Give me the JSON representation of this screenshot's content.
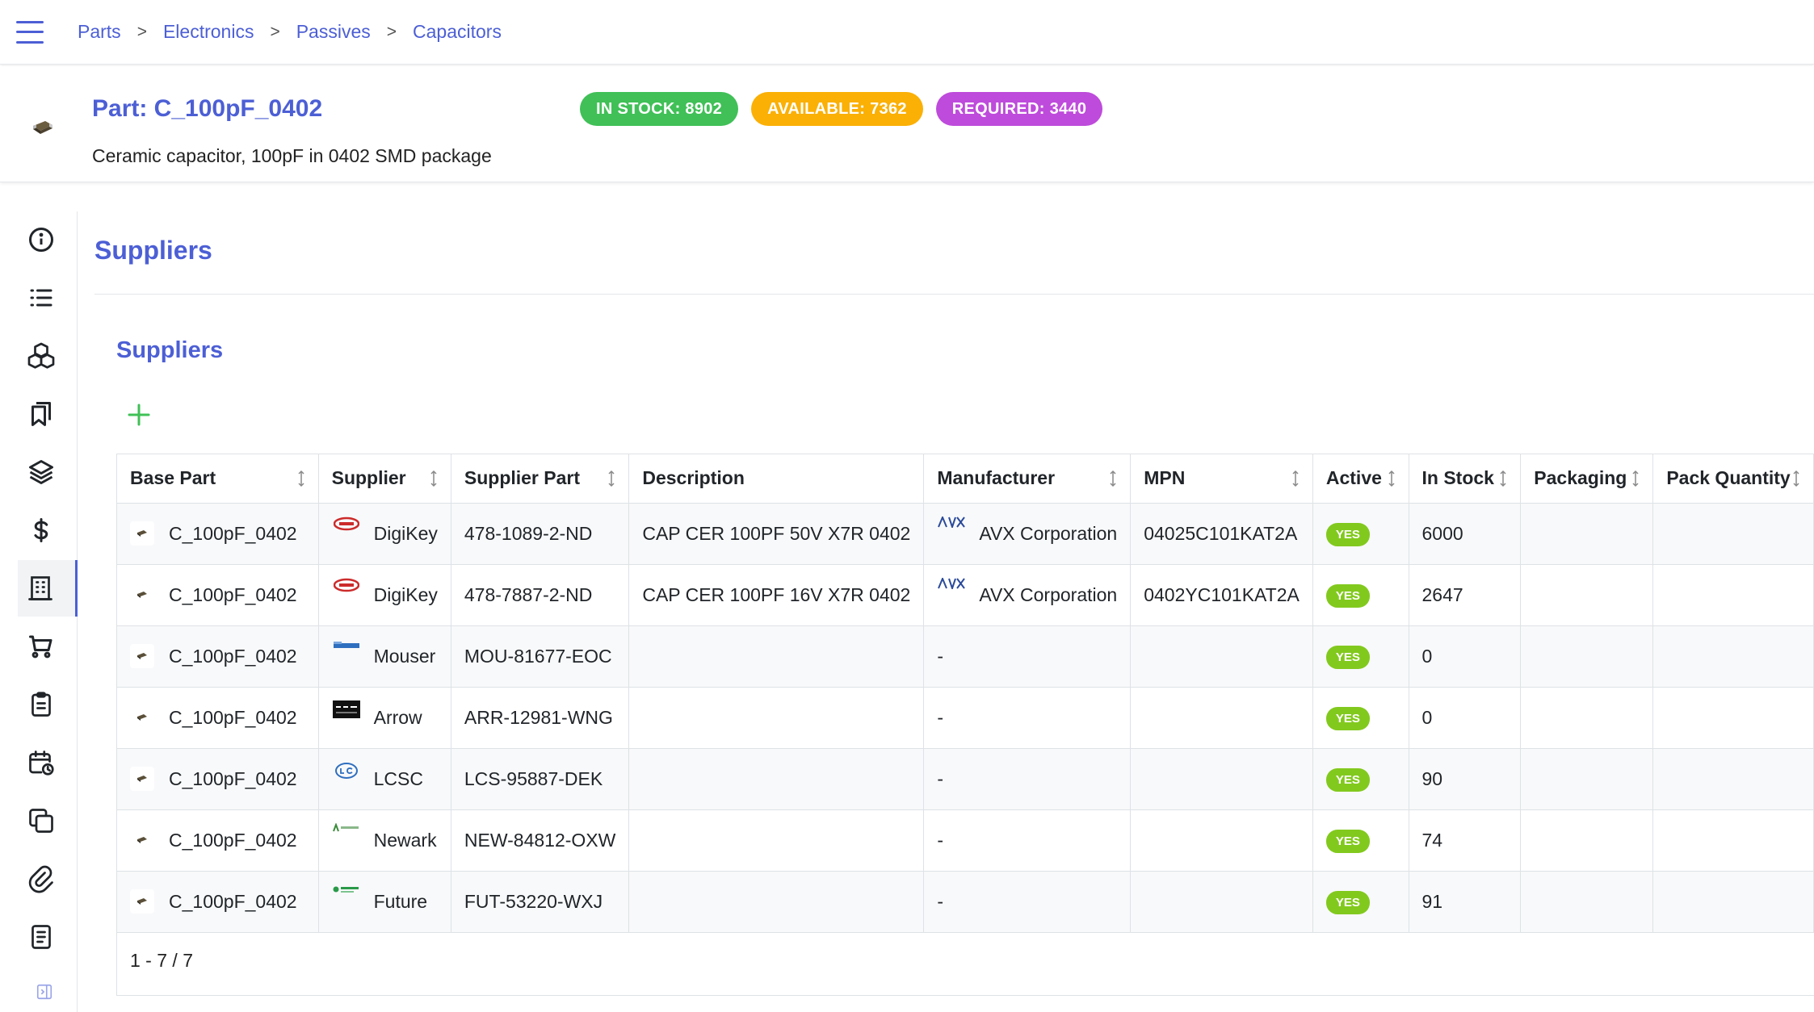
{
  "breadcrumb": [
    "Parts",
    "Electronics",
    "Passives",
    "Capacitors"
  ],
  "breadcrumb_separator": ">",
  "part": {
    "title": "Part: C_100pF_0402",
    "description": "Ceramic capacitor, 100pF in 0402 SMD package"
  },
  "badges": [
    {
      "label": "IN STOCK: 8902",
      "color": "#40c057"
    },
    {
      "label": "AVAILABLE: 7362",
      "color": "#fab005"
    },
    {
      "label": "REQUIRED: 3440",
      "color": "#be4bdb"
    }
  ],
  "sidebar": {
    "items": [
      {
        "icon": "info-icon"
      },
      {
        "icon": "list-icon"
      },
      {
        "icon": "boxes-icon"
      },
      {
        "icon": "bookmarks-icon"
      },
      {
        "icon": "stack-icon"
      },
      {
        "icon": "dollar-icon"
      },
      {
        "icon": "building-icon",
        "active": true
      },
      {
        "icon": "cart-icon"
      },
      {
        "icon": "clipboard-icon"
      },
      {
        "icon": "calendar-icon"
      },
      {
        "icon": "copy-icon"
      },
      {
        "icon": "paperclip-icon"
      },
      {
        "icon": "notes-icon"
      }
    ]
  },
  "section_title": "Suppliers",
  "panel_title": "Suppliers",
  "table": {
    "columns": [
      "Base Part",
      "Supplier",
      "Supplier Part",
      "Description",
      "Manufacturer",
      "MPN",
      "Active",
      "In Stock",
      "Packaging",
      "Pack Quantity"
    ],
    "rows": [
      {
        "base_part": "C_100pF_0402",
        "supplier": "DigiKey",
        "supplier_part": "478-1089-2-ND",
        "description": "CAP CER 100PF 50V X7R 0402",
        "manufacturer": "AVX Corporation",
        "mpn": "04025C101KAT2A",
        "active": "YES",
        "in_stock": "6000",
        "packaging": "",
        "pack_quantity": ""
      },
      {
        "base_part": "C_100pF_0402",
        "supplier": "DigiKey",
        "supplier_part": "478-7887-2-ND",
        "description": "CAP CER 100PF 16V X7R 0402",
        "manufacturer": "AVX Corporation",
        "mpn": "0402YC101KAT2A",
        "active": "YES",
        "in_stock": "2647",
        "packaging": "",
        "pack_quantity": ""
      },
      {
        "base_part": "C_100pF_0402",
        "supplier": "Mouser",
        "supplier_part": "MOU-81677-EOC",
        "description": "",
        "manufacturer": "-",
        "mpn": "",
        "active": "YES",
        "in_stock": "0",
        "packaging": "",
        "pack_quantity": ""
      },
      {
        "base_part": "C_100pF_0402",
        "supplier": "Arrow",
        "supplier_part": "ARR-12981-WNG",
        "description": "",
        "manufacturer": "-",
        "mpn": "",
        "active": "YES",
        "in_stock": "0",
        "packaging": "",
        "pack_quantity": ""
      },
      {
        "base_part": "C_100pF_0402",
        "supplier": "LCSC",
        "supplier_part": "LCS-95887-DEK",
        "description": "",
        "manufacturer": "-",
        "mpn": "",
        "active": "YES",
        "in_stock": "90",
        "packaging": "",
        "pack_quantity": ""
      },
      {
        "base_part": "C_100pF_0402",
        "supplier": "Newark",
        "supplier_part": "NEW-84812-OXW",
        "description": "",
        "manufacturer": "-",
        "mpn": "",
        "active": "YES",
        "in_stock": "74",
        "packaging": "",
        "pack_quantity": ""
      },
      {
        "base_part": "C_100pF_0402",
        "supplier": "Future",
        "supplier_part": "FUT-53220-WXJ",
        "description": "",
        "manufacturer": "-",
        "mpn": "",
        "active": "YES",
        "in_stock": "91",
        "packaging": "",
        "pack_quantity": ""
      }
    ],
    "pagination": "1 - 7 / 7"
  },
  "colors": {
    "accent": "#4c5fd5",
    "yes_badge": "#82c91e",
    "add_button": "#40c057"
  }
}
